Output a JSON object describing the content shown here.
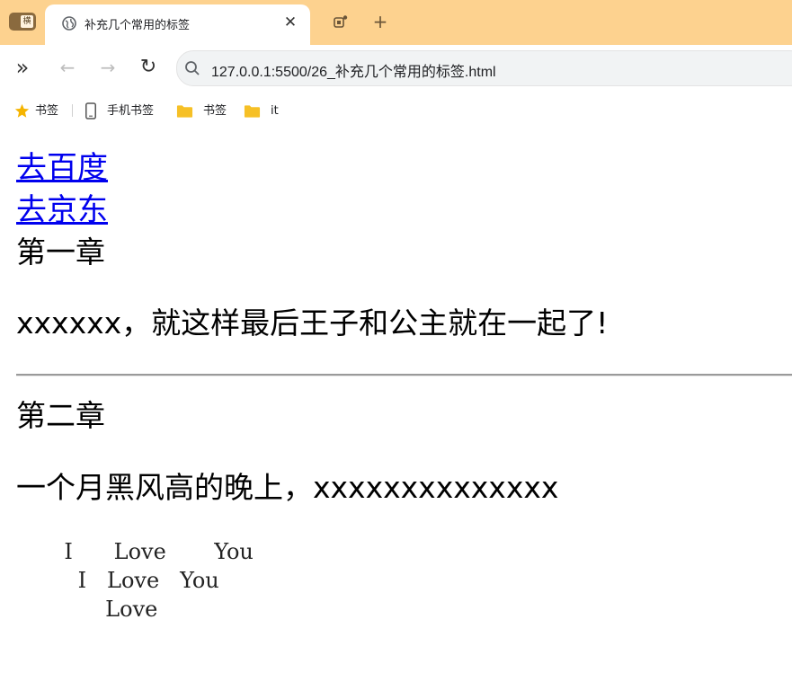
{
  "browser": {
    "sidebar_badge": "横",
    "tab": {
      "title": "补充几个常用的标签",
      "close_glyph": "✕"
    },
    "new_tab_glyph": "+",
    "toolbar": {
      "forward_more_glyph": "»",
      "back_glyph": "←",
      "forward_glyph": "→",
      "reload_glyph": "↻",
      "url": "127.0.0.1:5500/26_补充几个常用的标签.html"
    },
    "bookmarks": [
      {
        "label": "书签",
        "icon": "star-icon"
      },
      {
        "label": "手机书签",
        "icon": "phone-icon"
      },
      {
        "label": "书签",
        "icon": "folder-icon"
      },
      {
        "label": "it",
        "icon": "folder-icon"
      }
    ]
  },
  "page": {
    "link_baidu": "去百度",
    "link_jd": "去京东",
    "chapter1_title": "第一章",
    "chapter1_text": "xxxxxx，就这样最后王子和公主就在一起了!",
    "chapter2_title": "第二章",
    "chapter2_text": "一个月黑风高的晚上，xxxxxxxxxxxxxx",
    "pre_text": "       I      Love       You\n         I   Love   You\n             Love"
  },
  "colors": {
    "tabstrip": "#fdd28f",
    "link": "#0000ee",
    "folder": "#f6c026",
    "star": "#f5b400"
  }
}
